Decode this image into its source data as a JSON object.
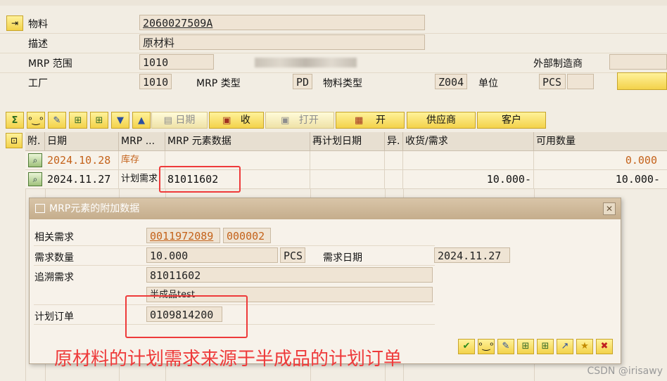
{
  "header": {
    "material_label": "物料",
    "material_value": "2060027509A",
    "desc_label": "描述",
    "desc_value": "原材料",
    "mrp_area_label": "MRP 范围",
    "mrp_area_value": "1010",
    "plant_label": "工厂",
    "plant_value": "1010",
    "mrp_type_label": "MRP 类型",
    "mrp_type_value": "PD",
    "mat_type_label": "物料类型",
    "mat_type_value": "Z004",
    "unit_label": "单位",
    "unit_value": "PCS",
    "ext_label": "外部制造商"
  },
  "toolbar": {
    "date_label": "日期",
    "receive_label": "收",
    "open_label": "打开",
    "open2_label": "开",
    "vendor_label": "供应商",
    "customer_label": "客户"
  },
  "grid": {
    "columns": [
      "附.",
      "日期",
      "MRP ...",
      "MRP 元素数据",
      "再计划日期",
      "异.",
      "收货/需求",
      "可用数量"
    ],
    "rows": [
      {
        "date": "2024.10.28",
        "mrp": "库存",
        "element": "",
        "reschedule": "",
        "exc": "",
        "qty": "",
        "avail": "0.000"
      },
      {
        "date": "2024.11.27",
        "mrp": "计划需求",
        "element": "81011602",
        "reschedule": "",
        "exc": "",
        "qty": "10.000-",
        "avail": "10.000-"
      }
    ]
  },
  "dialog": {
    "title": "MRP元素的附加数据",
    "related_label": "相关需求",
    "related_value": "0011972089",
    "related_item": "000002",
    "req_qty_label": "需求数量",
    "req_qty_value": "10.000",
    "req_qty_unit": "PCS",
    "req_date_label": "需求日期",
    "req_date_value": "2024.11.27",
    "peg_label": "追溯需求",
    "peg_value": "81011602",
    "peg_desc": "半成品test",
    "plan_order_label": "计划订单",
    "plan_order_value": "0109814200"
  },
  "annotation": "原材料的计划需求来源于半成品的计划订单",
  "watermark": "CSDN @irisawy",
  "colors": {
    "toolbar": "#f3d24a",
    "annotation": "#ee3a3a",
    "stock_row": "#c4621a"
  }
}
